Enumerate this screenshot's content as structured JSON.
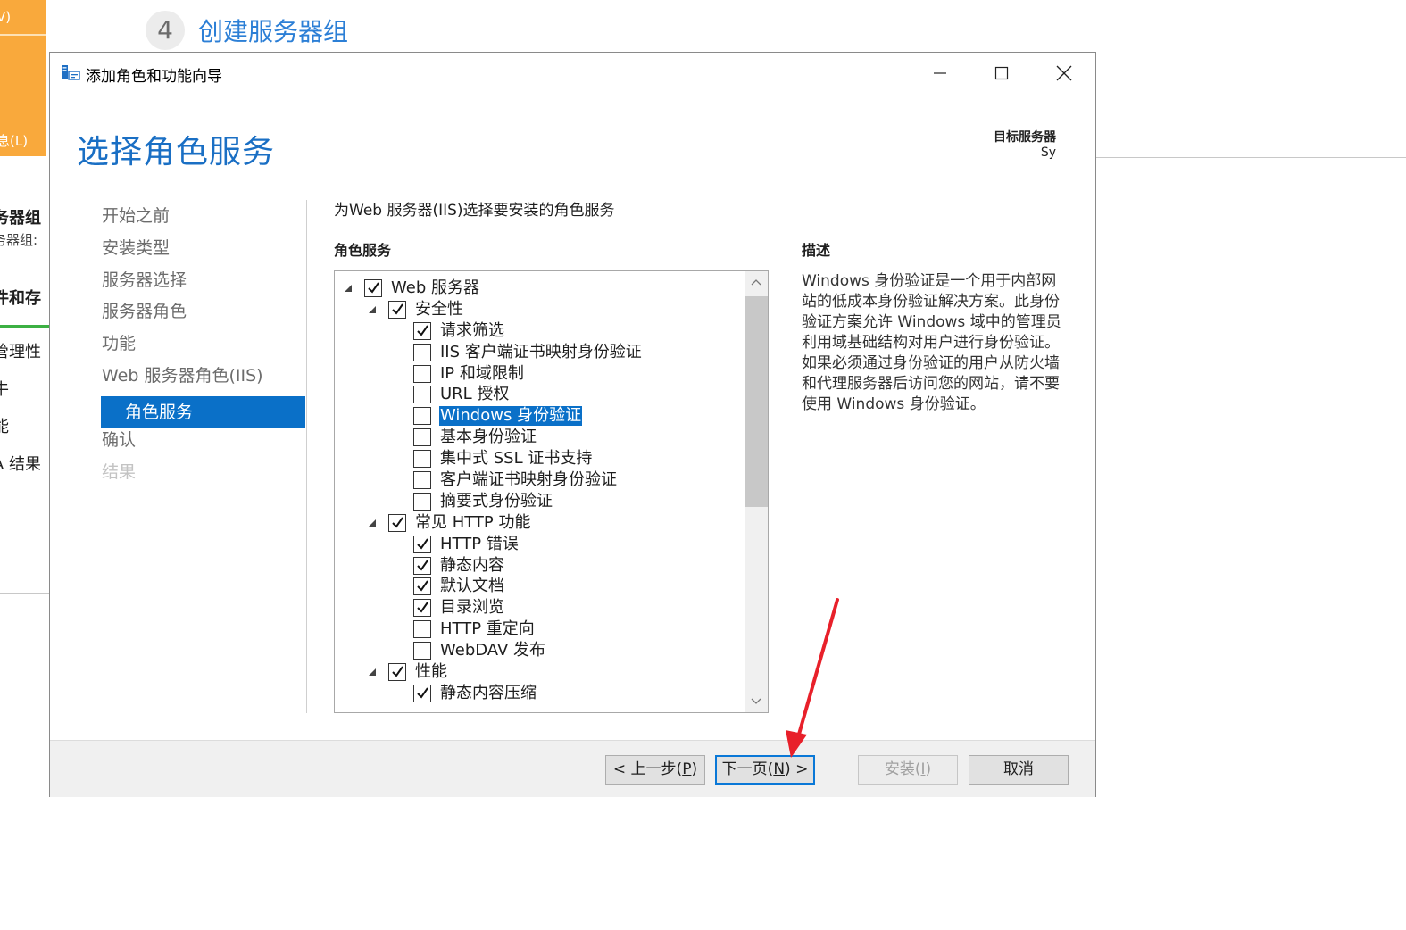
{
  "background": {
    "step_number": "4",
    "step_title": "创建服务器组",
    "left_texts": [
      "V)",
      "息(L)",
      "务器组",
      "务器组:",
      "件和存",
      "管理性",
      "牛",
      "能",
      "A 结果"
    ]
  },
  "window": {
    "title": "添加角色和功能向导",
    "page_title": "选择角色服务",
    "target_server_label": "目标服务器",
    "target_server_value": "Sy"
  },
  "nav": {
    "items": [
      {
        "label": "开始之前",
        "state": "normal"
      },
      {
        "label": "安装类型",
        "state": "normal"
      },
      {
        "label": "服务器选择",
        "state": "normal"
      },
      {
        "label": "服务器角色",
        "state": "normal"
      },
      {
        "label": "功能",
        "state": "normal"
      },
      {
        "label": "Web 服务器角色(IIS)",
        "state": "normal"
      },
      {
        "label": "角色服务",
        "state": "active"
      },
      {
        "label": "确认",
        "state": "normal"
      },
      {
        "label": "结果",
        "state": "disabled"
      }
    ]
  },
  "main": {
    "instruction": "为Web 服务器(IIS)选择要安装的角色服务",
    "role_services_header": "角色服务",
    "tree": [
      {
        "label": "Web 服务器",
        "level": 0,
        "checked": true,
        "expandable": true,
        "selected": false
      },
      {
        "label": "安全性",
        "level": 1,
        "checked": true,
        "expandable": true,
        "selected": false
      },
      {
        "label": "请求筛选",
        "level": 2,
        "checked": true,
        "expandable": false,
        "selected": false
      },
      {
        "label": "IIS 客户端证书映射身份验证",
        "level": 2,
        "checked": false,
        "expandable": false,
        "selected": false
      },
      {
        "label": "IP 和域限制",
        "level": 2,
        "checked": false,
        "expandable": false,
        "selected": false
      },
      {
        "label": "URL 授权",
        "level": 2,
        "checked": false,
        "expandable": false,
        "selected": false
      },
      {
        "label": "Windows 身份验证",
        "level": 2,
        "checked": false,
        "expandable": false,
        "selected": true
      },
      {
        "label": "基本身份验证",
        "level": 2,
        "checked": false,
        "expandable": false,
        "selected": false
      },
      {
        "label": "集中式 SSL 证书支持",
        "level": 2,
        "checked": false,
        "expandable": false,
        "selected": false
      },
      {
        "label": "客户端证书映射身份验证",
        "level": 2,
        "checked": false,
        "expandable": false,
        "selected": false
      },
      {
        "label": "摘要式身份验证",
        "level": 2,
        "checked": false,
        "expandable": false,
        "selected": false
      },
      {
        "label": "常见 HTTP 功能",
        "level": 1,
        "checked": true,
        "expandable": true,
        "selected": false
      },
      {
        "label": "HTTP 错误",
        "level": 2,
        "checked": true,
        "expandable": false,
        "selected": false
      },
      {
        "label": "静态内容",
        "level": 2,
        "checked": true,
        "expandable": false,
        "selected": false
      },
      {
        "label": "默认文档",
        "level": 2,
        "checked": true,
        "expandable": false,
        "selected": false
      },
      {
        "label": "目录浏览",
        "level": 2,
        "checked": true,
        "expandable": false,
        "selected": false
      },
      {
        "label": "HTTP 重定向",
        "level": 2,
        "checked": false,
        "expandable": false,
        "selected": false
      },
      {
        "label": "WebDAV 发布",
        "level": 2,
        "checked": false,
        "expandable": false,
        "selected": false
      },
      {
        "label": "性能",
        "level": 1,
        "checked": true,
        "expandable": true,
        "selected": false
      },
      {
        "label": "静态内容压缩",
        "level": 2,
        "checked": true,
        "expandable": false,
        "selected": false
      }
    ],
    "description_header": "描述",
    "description_text": "Windows 身份验证是一个用于内部网站的低成本身份验证解决方案。此身份验证方案允许 Windows 域中的管理员利用域基础结构对用户进行身份验证。如果必须通过身份验证的用户从防火墙和代理服务器后访问您的网站，请不要使用 Windows 身份验证。"
  },
  "footer": {
    "prev_label": "< 上一步(",
    "prev_key": "P",
    "prev_end": ")",
    "next_label": "下一页(",
    "next_key": "N",
    "next_end": ") >",
    "install_label": "安装(",
    "install_key": "I",
    "install_end": ")",
    "cancel_label": "取消"
  },
  "colors": {
    "accent": "#0a70c8",
    "title_blue": "#1a6fc4",
    "background_orange": "#f9a93c",
    "annotation_red": "#e8202a"
  }
}
